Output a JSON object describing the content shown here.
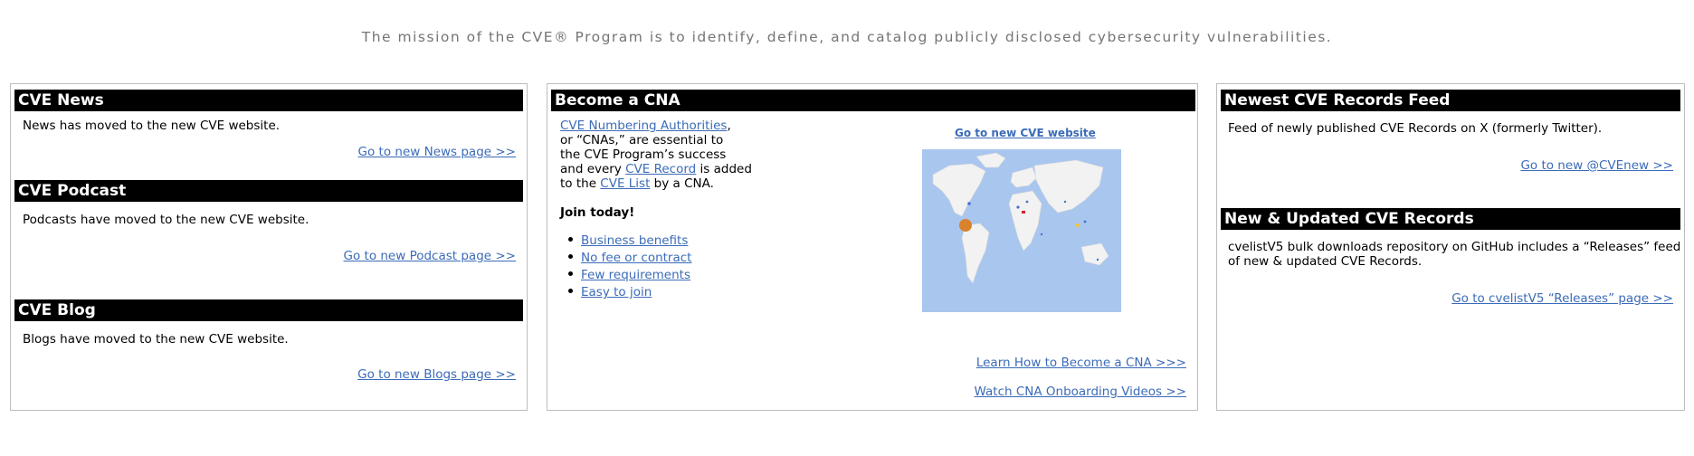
{
  "mission": "The mission of the CVE® Program is to identify, define, and catalog publicly disclosed cybersecurity vulnerabilities.",
  "left": {
    "news": {
      "title": "CVE News",
      "text": "News has moved to the new CVE website.",
      "link": "Go to new News page >>"
    },
    "podcast": {
      "title": "CVE Podcast",
      "text": "Podcasts have moved to the new CVE website.",
      "link": "Go to new Podcast page >>"
    },
    "blog": {
      "title": "CVE Blog",
      "text": "Blogs have moved to the new CVE website.",
      "link": "Go to new Blogs page >>"
    }
  },
  "middle": {
    "title": "Become a CNA",
    "intro": {
      "cna_link": "CVE Numbering Authorities",
      "part1": ",",
      "part2": "or “CNAs,” are essential to",
      "part3": "the CVE Program’s success",
      "part4a": "and every ",
      "record_link": "CVE Record",
      "part4b": " is added",
      "part5a": "to the ",
      "list_link": "CVE List",
      "part5b": " by a CNA."
    },
    "join": "Join today!",
    "bullets": [
      "Business benefits",
      "No fee or contract",
      "Few requirements",
      "Easy to join"
    ],
    "site_link": "Go to new CVE website",
    "learn_link": "Learn How to Become a CNA >>>",
    "videos_link": "Watch CNA Onboarding Videos >>",
    "map_colors": {
      "ocean": "#a9c6ef",
      "land": "#f2f2f2",
      "major": "#d9822b",
      "red": "#d6232f",
      "blue": "#4a6fd0",
      "yellow": "#f0c540"
    }
  },
  "right": {
    "feed": {
      "title": "Newest CVE Records Feed",
      "text": "Feed of newly published CVE Records on X (formerly Twitter).",
      "link": "Go to new @CVEnew >>"
    },
    "updated": {
      "title": "New & Updated CVE Records",
      "line1": "cvelistV5 bulk downloads repository on GitHub includes a “Releases” feed",
      "line2": "of new & updated CVE Records.",
      "link": "Go to cvelistV5 “Releases” page >>"
    }
  }
}
